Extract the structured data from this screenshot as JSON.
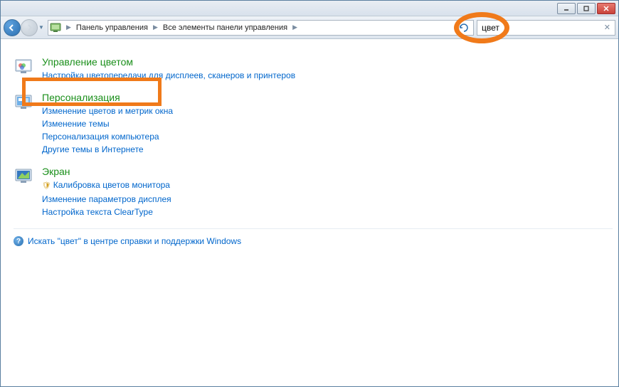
{
  "titlebar": {},
  "nav": {
    "breadcrumbs": [
      "Панель управления",
      "Все элементы панели управления"
    ]
  },
  "search": {
    "value": "цвет"
  },
  "results": [
    {
      "title": "Управление цветом",
      "links": [
        {
          "label": "Настройка цветопередачи для дисплеев, сканеров и принтеров",
          "shield": false
        }
      ]
    },
    {
      "title": "Персонализация",
      "links": [
        {
          "label": "Изменение цветов и метрик окна",
          "shield": false
        },
        {
          "label": "Изменение темы",
          "shield": false
        },
        {
          "label": "Персонализация компьютера",
          "shield": false
        },
        {
          "label": "Другие темы в Интернете",
          "shield": false
        }
      ]
    },
    {
      "title": "Экран",
      "links": [
        {
          "label": "Калибровка цветов монитора",
          "shield": true
        },
        {
          "label": "Изменение параметров дисплея",
          "shield": false
        },
        {
          "label": "Настройка текста ClearType",
          "shield": false
        }
      ]
    }
  ],
  "help": {
    "label": "Искать \"цвет\" в центре справки и поддержки Windows"
  }
}
